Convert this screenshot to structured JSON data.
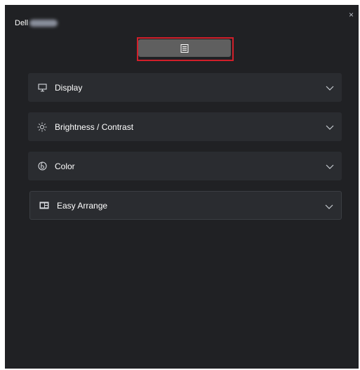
{
  "window": {
    "title": "Dell",
    "close_glyph": "×"
  },
  "toolbar": {
    "button_icon": "menu-list-icon"
  },
  "sections": [
    {
      "label": "Display",
      "icon": "monitor-icon"
    },
    {
      "label": "Brightness / Contrast",
      "icon": "brightness-icon"
    },
    {
      "label": "Color",
      "icon": "color-palette-icon"
    },
    {
      "label": "Easy Arrange",
      "icon": "easy-arrange-icon"
    }
  ],
  "colors": {
    "background": "#202124",
    "panel": "#2a2c30",
    "highlight": "#d21f2a",
    "button": "#5f5f5f"
  }
}
